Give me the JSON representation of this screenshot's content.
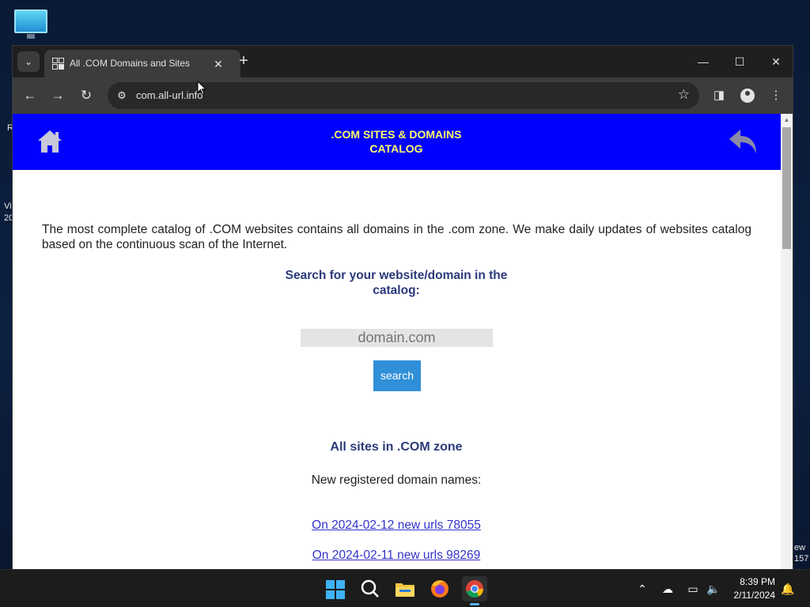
{
  "desktop": {
    "side_labels": [
      "R",
      "Vi",
      "20",
      "ew",
      "157"
    ]
  },
  "browser": {
    "tab_title": "All .COM Domains and Sites",
    "url": "com.all-url.info",
    "window_controls": {
      "minimize": "—",
      "maximize": "☐",
      "close": "✕"
    }
  },
  "site": {
    "header_title_line1": ".COM SITES & DOMAINS",
    "header_title_line2": "CATALOG",
    "intro": "The most complete catalog of .COM websites contains all domains in the .com zone. We make daily updates of websites catalog based on the continuous scan of the Internet.",
    "search_heading_line1": "Search for your website/domain in the",
    "search_heading_line2": "catalog:",
    "search_placeholder": "domain.com",
    "search_button": "search",
    "zone_heading": "All sites in .COM zone",
    "new_registered": "New registered domain names:",
    "daily_links": [
      "On 2024-02-12 new urls 78055",
      "On 2024-02-11 new urls 98269"
    ]
  },
  "taskbar": {
    "time": "8:39 PM",
    "date": "2/11/2024"
  },
  "colors": {
    "header_bg": "#0000ff",
    "header_text": "#ffff66",
    "heading_text": "#2b3a7a",
    "link": "#3333cc",
    "button": "#2f8fd8"
  }
}
